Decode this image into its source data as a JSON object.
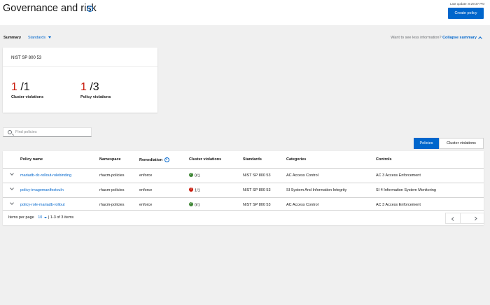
{
  "header": {
    "title": "Governance and risk",
    "last_update": "Last update: 8:29:37 PM",
    "create_button": "Create policy"
  },
  "summary_bar": {
    "label": "Summary",
    "view_select": "Standards",
    "see_less_text": "Want to see less information?",
    "collapse_link": "Collapse summary"
  },
  "summary_card": {
    "title": "NIST SP 800 53",
    "cluster": {
      "violations": "1",
      "total": "/1",
      "label": "Cluster violations"
    },
    "policy": {
      "violations": "1",
      "total": "/3",
      "label": "Policy violations"
    }
  },
  "search": {
    "placeholder": "Find policies",
    "value": ""
  },
  "view_toggle": {
    "policies": "Policies",
    "cluster_violations": "Cluster violations",
    "active": "Policies"
  },
  "table": {
    "headers": {
      "policy_name": "Policy name",
      "namespace": "Namespace",
      "remediation": "Remediation",
      "cluster_violations": "Cluster violations",
      "standards": "Standards",
      "categories": "Categories",
      "controls": "Controls"
    },
    "rows": [
      {
        "name": "mariadb-dc-rollout-rolebinding",
        "namespace": "rhacm-policies",
        "remediation": "enforce",
        "violations": "0/1",
        "status": "ok",
        "standards": "NIST SP 800 53",
        "categories": "AC Access Control",
        "controls": "AC 3 Access Enforcement"
      },
      {
        "name": "policy-imagemanifestvuln",
        "namespace": "rhacm-policies",
        "remediation": "enforce",
        "violations": "1/1",
        "status": "violation",
        "standards": "NIST SP 800 53",
        "categories": "SI System And Information Integrity",
        "controls": "SI 4 Information System Monitoring"
      },
      {
        "name": "policy-role-mariadb-rollout",
        "namespace": "rhacm-policies",
        "remediation": "enforce",
        "violations": "0/1",
        "status": "ok",
        "standards": "NIST SP 800 53",
        "categories": "AC Access Control",
        "controls": "AC 3 Access Enforcement"
      }
    ]
  },
  "pagination": {
    "items_per_page_label": "Items per page",
    "per_page_value": "10",
    "range_text": "| 1-3 of 3 items"
  },
  "colors": {
    "accent": "#0066cc",
    "danger": "#c9190b",
    "success": "#3e8635"
  }
}
